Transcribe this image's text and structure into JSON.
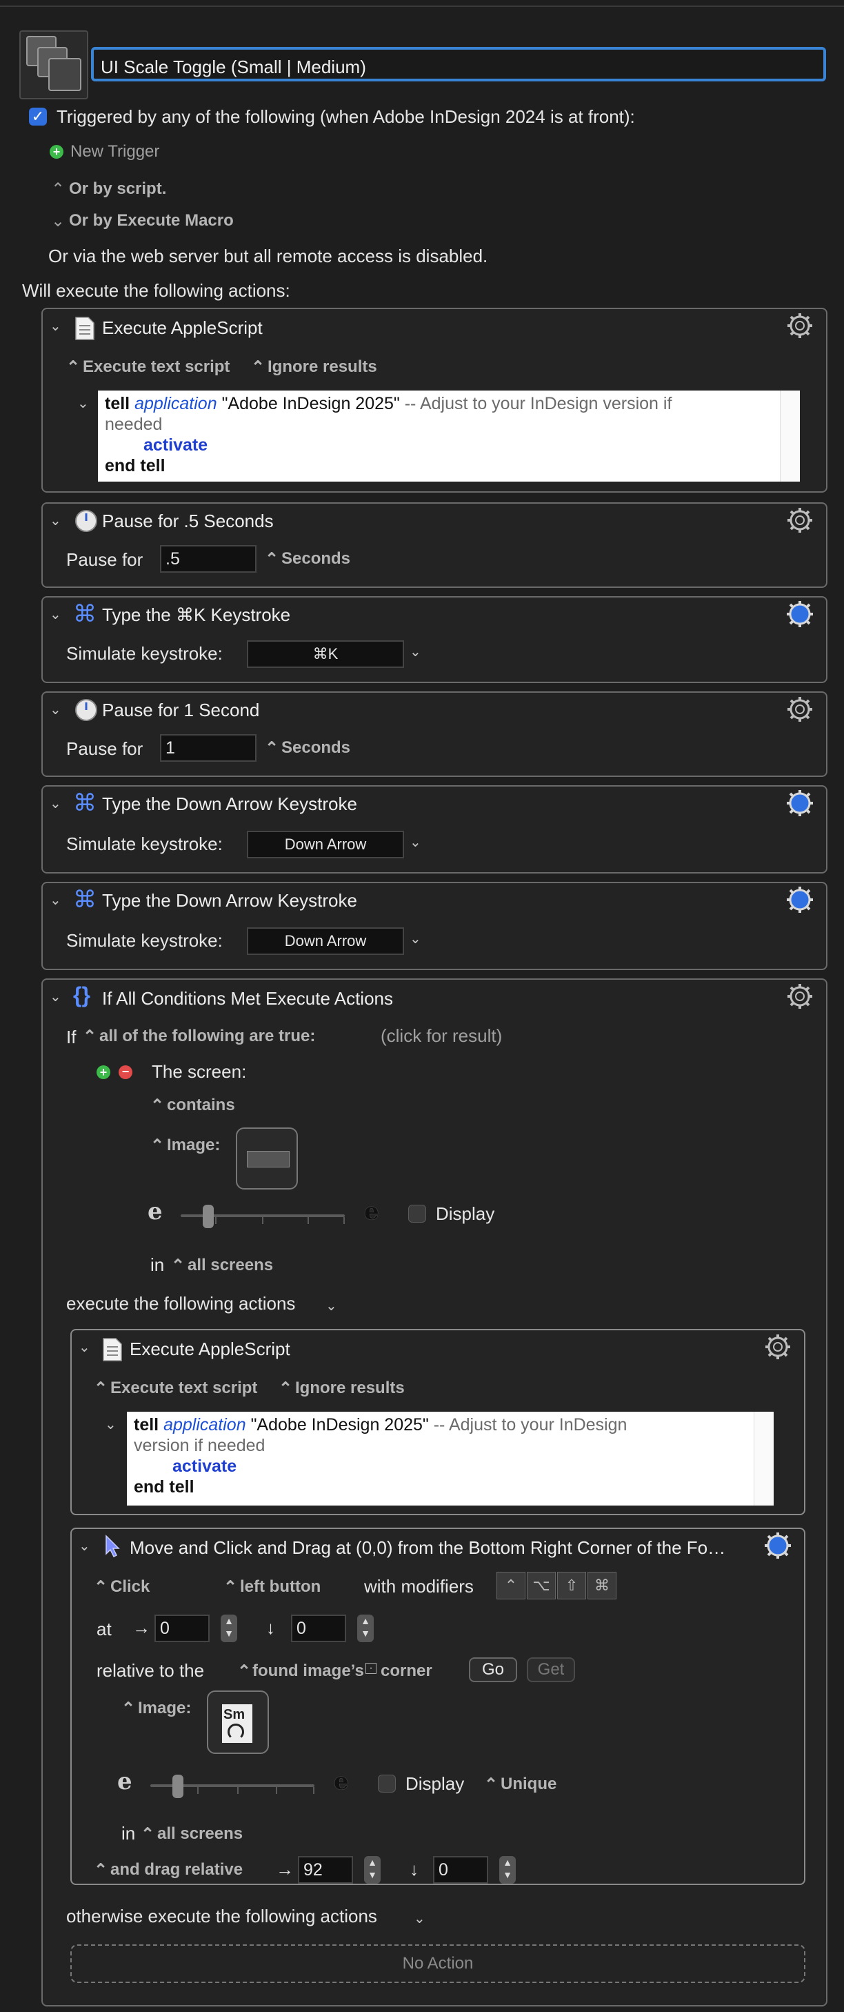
{
  "macro": {
    "title": "UI Scale Toggle (Small | Medium)",
    "trigger_text": "Triggered by any of the following (when Adobe InDesign 2024 is at front):",
    "new_trigger": "New Trigger",
    "or_by_script": "Or by script.",
    "or_by_execute_macro": "Or by Execute Macro",
    "web_server": "Or via the web server but all remote access is disabled.",
    "will_execute": "Will execute the following actions:"
  },
  "actions": [
    {
      "title": "Execute AppleScript",
      "opt1": "Execute text script",
      "opt2": "Ignore results",
      "script": {
        "tell": "tell",
        "application": "application",
        "target": "\"Adobe InDesign 2025\"",
        "comment1": "-- Adjust to your InDesign version if",
        "comment2": "needed",
        "activate": "activate",
        "end": "end tell"
      }
    },
    {
      "title": "Pause for .5 Seconds",
      "label": "Pause for",
      "value": ".5",
      "unit": "Seconds"
    },
    {
      "title": "Type the ⌘K Keystroke",
      "label": "Simulate keystroke:",
      "value": "⌘K"
    },
    {
      "title": "Pause for 1 Second",
      "label": "Pause for",
      "value": "1",
      "unit": "Seconds"
    },
    {
      "title": "Type the Down Arrow Keystroke",
      "label": "Simulate keystroke:",
      "value": "Down Arrow"
    },
    {
      "title": "Type the Down Arrow Keystroke",
      "label": "Simulate keystroke:",
      "value": "Down Arrow"
    }
  ],
  "if_action": {
    "title": "If All Conditions Met Execute Actions",
    "if": "If",
    "condition_mode": "all of the following are true:",
    "click_for_result": "(click for result)",
    "screen_label": "The screen:",
    "contains": "contains",
    "image_label": "Image:",
    "e_glyph": "e",
    "display": "Display",
    "in": "in",
    "all_screens": "all screens",
    "execute_following": "execute the following actions",
    "inner_script": {
      "title": "Execute AppleScript",
      "opt1": "Execute text script",
      "opt2": "Ignore results",
      "tell": "tell",
      "application": "application",
      "target": "\"Adobe InDesign 2025\"",
      "comment1": "-- Adjust to your InDesign",
      "comment2": "version if needed",
      "activate": "activate",
      "end": "end tell"
    },
    "click_action": {
      "title": "Move and Click and Drag at (0,0) from the Bottom Right Corner of the Fo…",
      "click": "Click",
      "button": "left button",
      "with_modifiers": "with modifiers",
      "at": "at",
      "x": "0",
      "y": "0",
      "relative_to": "relative to the",
      "found_image": "found image’s",
      "corner": "corner",
      "go": "Go",
      "get": "Get",
      "image_label": "Image:",
      "image_thumb_text": "Sm",
      "display": "Display",
      "unique": "Unique",
      "in": "in",
      "all_screens": "all screens",
      "drag_relative": "and drag relative",
      "dx": "92",
      "dy": "0"
    },
    "otherwise": "otherwise execute the following actions",
    "no_action": "No Action"
  },
  "colors": {
    "accent": "#2f6fe0",
    "focus": "#3a84d6",
    "gear_blue": "#2f6fe0"
  }
}
